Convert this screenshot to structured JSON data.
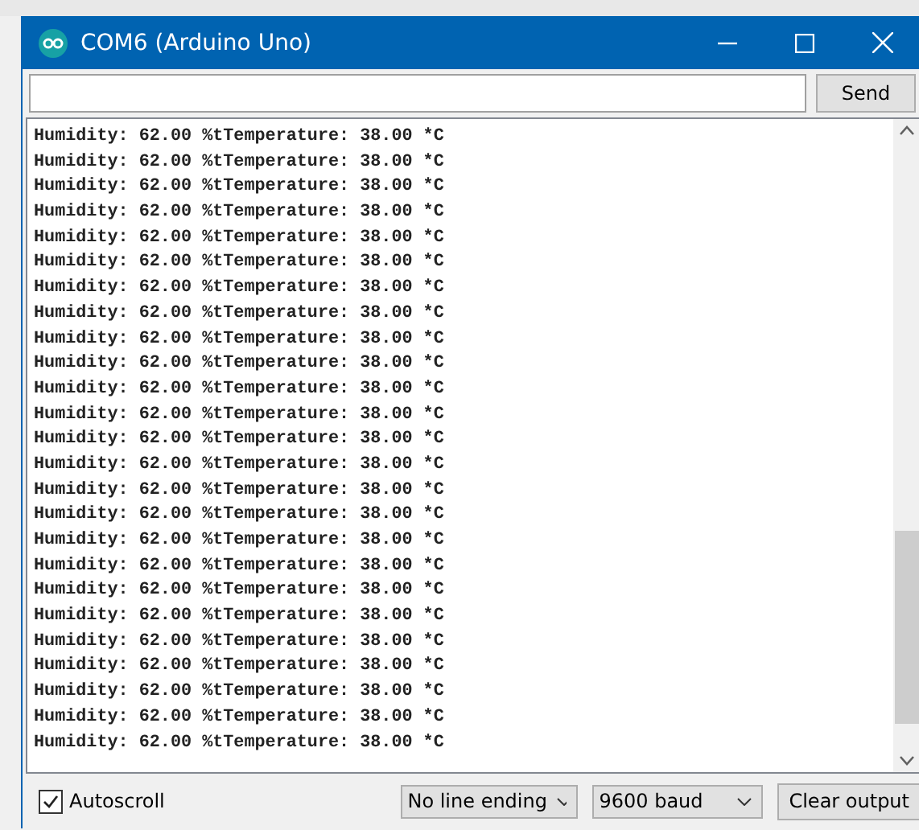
{
  "window": {
    "title": "COM6 (Arduino Uno)"
  },
  "input": {
    "send_label": "Send"
  },
  "output": {
    "lines": [
      "Humidity: 62.00 %tTemperature: 38.00 *C",
      "Humidity: 62.00 %tTemperature: 38.00 *C",
      "Humidity: 62.00 %tTemperature: 38.00 *C",
      "Humidity: 62.00 %tTemperature: 38.00 *C",
      "Humidity: 62.00 %tTemperature: 38.00 *C",
      "Humidity: 62.00 %tTemperature: 38.00 *C",
      "Humidity: 62.00 %tTemperature: 38.00 *C",
      "Humidity: 62.00 %tTemperature: 38.00 *C",
      "Humidity: 62.00 %tTemperature: 38.00 *C",
      "Humidity: 62.00 %tTemperature: 38.00 *C",
      "Humidity: 62.00 %tTemperature: 38.00 *C",
      "Humidity: 62.00 %tTemperature: 38.00 *C",
      "Humidity: 62.00 %tTemperature: 38.00 *C",
      "Humidity: 62.00 %tTemperature: 38.00 *C",
      "Humidity: 62.00 %tTemperature: 38.00 *C",
      "Humidity: 62.00 %tTemperature: 38.00 *C",
      "Humidity: 62.00 %tTemperature: 38.00 *C",
      "Humidity: 62.00 %tTemperature: 38.00 *C",
      "Humidity: 62.00 %tTemperature: 38.00 *C",
      "Humidity: 62.00 %tTemperature: 38.00 *C",
      "Humidity: 62.00 %tTemperature: 38.00 *C",
      "Humidity: 62.00 %tTemperature: 38.00 *C",
      "Humidity: 62.00 %tTemperature: 38.00 *C",
      "Humidity: 62.00 %tTemperature: 38.00 *C",
      "Humidity: 62.00 %tTemperature: 38.00 *C"
    ]
  },
  "footer": {
    "autoscroll": {
      "label": "Autoscroll",
      "checked": true
    },
    "line_ending": "No line ending",
    "baud": "9600 baud",
    "clear_label": "Clear output"
  }
}
